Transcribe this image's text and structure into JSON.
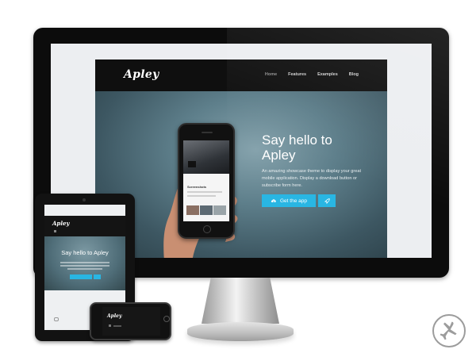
{
  "site": {
    "logo": "Apley",
    "nav": [
      "Home",
      "Features",
      "Examples",
      "Blog"
    ],
    "hero": {
      "title": "Say hello to Apley",
      "text": "An amazing showcase theme to display your great mobile application. Display a download button or subscribe form here.",
      "cta_label": "Get the app",
      "cta_icon": "cloud-download-icon",
      "secondary_icon": "rocket-icon"
    },
    "phone_screen": {
      "section_title": "Screenshots"
    }
  },
  "tablet": {
    "logo": "Apley",
    "hero_title": "Say hello to Apley"
  },
  "small_phone": {
    "logo": "Apley"
  },
  "badge": {
    "icon": "airplane-icon"
  },
  "colors": {
    "accent": "#29b6e3",
    "nav_bg": "#0f0f0f",
    "hero_bg": "#5e7f8b",
    "page_bg": "#ffffff"
  }
}
